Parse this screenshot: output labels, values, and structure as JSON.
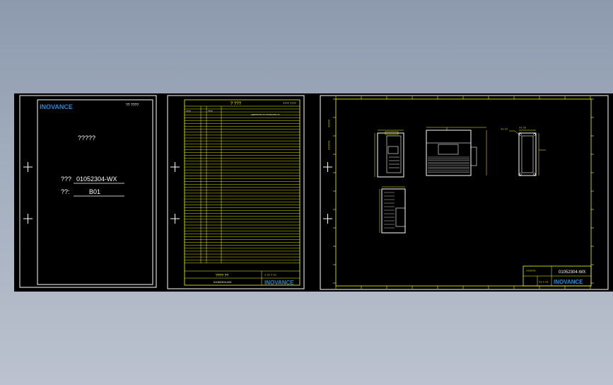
{
  "cover": {
    "logo": "INOVANCE",
    "top_right": "?? ????",
    "title": "?????",
    "part_label": "???",
    "part_value": "01052304-WX",
    "version_label": "??:",
    "version_value": "B01"
  },
  "revision": {
    "header_title": "? ???",
    "header_right": "???? ????",
    "row_values": [
      "????",
      "????",
      "A0R?????? ?? ?????(???) ??"
    ],
    "footer_label": "???? ??",
    "footer_code": "01052304-WX",
    "footer_page": "? ?? ? ??",
    "logo": "INOVANCE"
  },
  "drawing": {
    "side_label_top": "?????",
    "side_label_mid": "??????",
    "tb_left": "??????",
    "tb_code": "01052304-WX",
    "tb_mid": "?? ? ??",
    "logo": "INOVANCE",
    "dim_labels": [
      "?? ??",
      "?? ??"
    ]
  },
  "colors": {
    "canvas": "#000000",
    "frame": "#ffffff",
    "cad_yellow": "#ffff00",
    "logo_blue": "#1e8ad8",
    "background_top": "#8d9aae",
    "background_bottom": "#bcc2cf"
  }
}
